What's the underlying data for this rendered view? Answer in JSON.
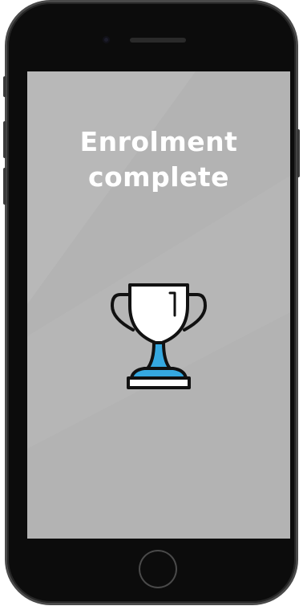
{
  "screen": {
    "title_line1": "Enrolment",
    "title_line2": "complete",
    "background_color": "#b3b3b3"
  },
  "trophy": {
    "icon": "trophy-icon",
    "accent_color": "#35a8e0"
  }
}
